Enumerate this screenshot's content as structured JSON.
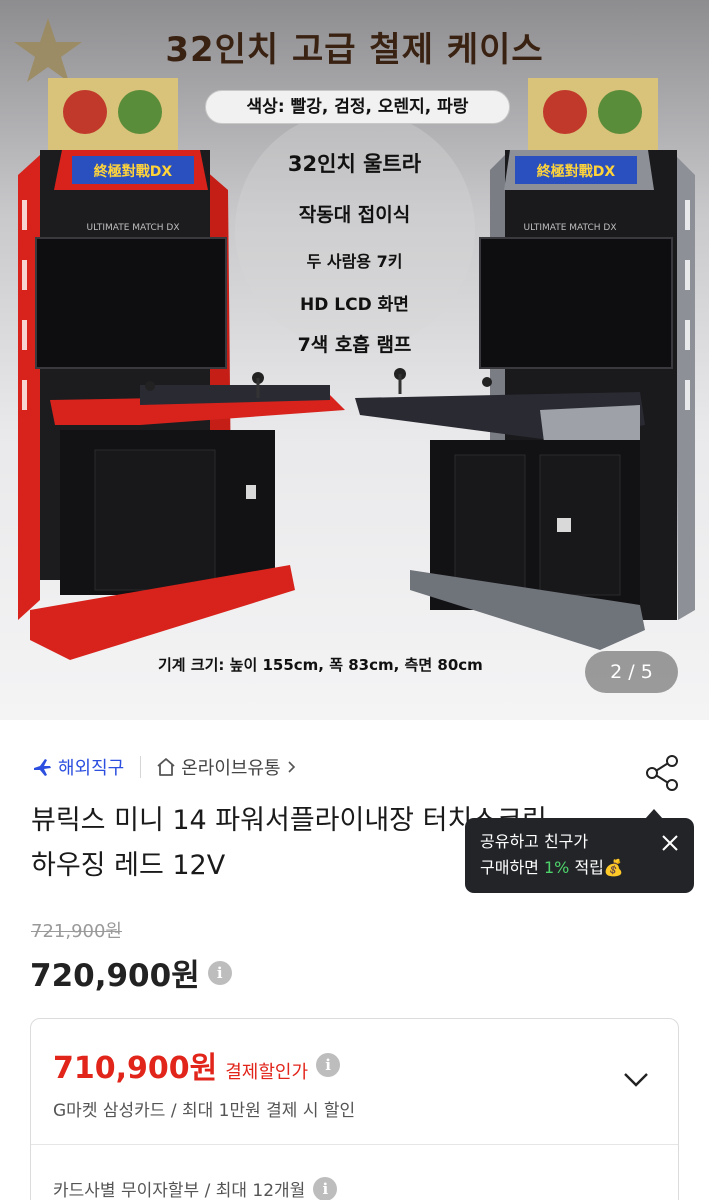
{
  "hero": {
    "banner_title": "32인치 고급 철제 케이스",
    "colors_pill": "색상: 빨강, 검정, 오렌지, 파랑",
    "features": [
      "32인치 울트라",
      "작동대 접이식",
      "두 사람용 7키",
      "HD LCD 화면",
      "7색 호흡 램프"
    ],
    "size_note": "기계 크기: 높이 155cm, 폭 83cm, 측면 80cm",
    "pager": "2 / 5",
    "cabinet_brand": "ULTIMATE MATCH DX"
  },
  "seller": {
    "direct_label": "해외직구",
    "store_label": "온라이브유통"
  },
  "product": {
    "title": "뷰릭스 미니 14 파워서플라이내장 터치스크린 하우징 레드 12V",
    "original_price": "721,900원",
    "price": "720,900원"
  },
  "share_tooltip": {
    "line1": "공유하고 친구가",
    "line2_prefix": "구매하면 ",
    "line2_pct": "1%",
    "line2_suffix": " 적립💰"
  },
  "payment_card": {
    "price": "710,900원",
    "label": "결제할인가",
    "sub": "G마켓 삼성카드 / 최대 1만원 결제 시 할인",
    "installment": "카드사별 무이자할부 / 최대 12개월"
  },
  "icons": {
    "info": "i",
    "direct": "airplane-icon",
    "store": "home-icon",
    "share": "share-icon",
    "close": "close-icon",
    "chevron": "chevron-down-icon"
  },
  "colors": {
    "accent_blue": "#2c4fe0",
    "discount_red": "#e1251b",
    "tooltip_bg": "#222428",
    "tooltip_green": "#4ed36b"
  }
}
